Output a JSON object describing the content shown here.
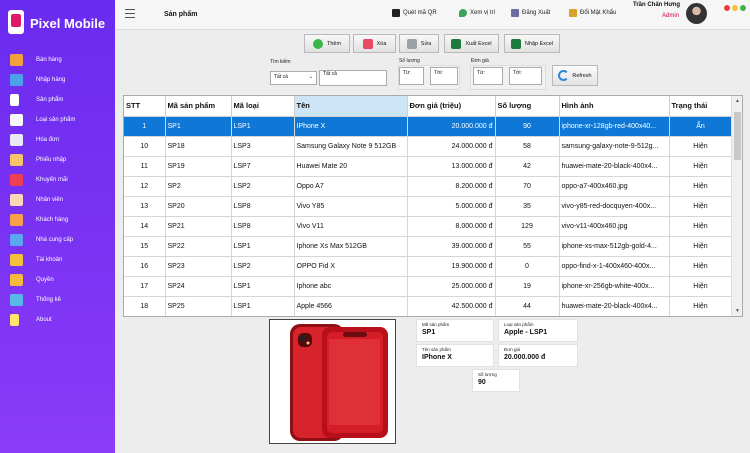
{
  "sidebar": {
    "app_name": "Pixel Mobile",
    "items": [
      {
        "label": "Bán hàng",
        "icon": "cash-register-icon",
        "color": "#f2a03a"
      },
      {
        "label": "Nhập hàng",
        "icon": "truck-icon",
        "color": "#4aa3e8"
      },
      {
        "label": "Sản phẩm",
        "icon": "phone-icon",
        "color": "#ffffff"
      },
      {
        "label": "Loại sản phẩm",
        "icon": "category-icon",
        "color": "#f7f7f7"
      },
      {
        "label": "Hóa đơn",
        "icon": "invoice-icon",
        "color": "#e9e9f6"
      },
      {
        "label": "Phiếu nhập",
        "icon": "clipboard-icon",
        "color": "#f6c46a"
      },
      {
        "label": "Khuyến mãi",
        "icon": "gift-icon",
        "color": "#ee3f55"
      },
      {
        "label": "Nhân viên",
        "icon": "staff-icon",
        "color": "#fbd7b5"
      },
      {
        "label": "Khách hàng",
        "icon": "customer-icon",
        "color": "#f6a14a"
      },
      {
        "label": "Nhà cung cấp",
        "icon": "supplier-icon",
        "color": "#5aa7f0"
      },
      {
        "label": "Tài khoản",
        "icon": "key-icon",
        "color": "#f3c13a"
      },
      {
        "label": "Quyền",
        "icon": "shield-icon",
        "color": "#f5b93b"
      },
      {
        "label": "Thống kê",
        "icon": "statistics-icon",
        "color": "#58b9e6"
      },
      {
        "label": "About",
        "icon": "info-icon",
        "color": "#ffe66b"
      }
    ]
  },
  "header": {
    "title": "Sản phẩm",
    "actions": [
      {
        "label": "Quét mã QR",
        "icon": "qr-code-icon"
      },
      {
        "label": "Xem vị trí",
        "icon": "location-pin-icon"
      },
      {
        "label": "Đăng Xuất",
        "icon": "logout-icon"
      },
      {
        "label": "Đổi Mật Khẩu",
        "icon": "key-icon"
      }
    ],
    "user_name": "Trần Chấn Hưng",
    "user_role": "Admin",
    "window_dots": [
      "#e4463d",
      "#f6c13d",
      "#3bb54a"
    ]
  },
  "toolbar": {
    "add": "Thêm",
    "delete": "Xóa",
    "edit": "Sửa",
    "export": "Xuất Excel",
    "import": "Nhập Excel"
  },
  "filters": {
    "search_label": "Tìm kiếm",
    "search_select": "Tất cả",
    "search_value": "Tất cả",
    "qty_label": "Số lượng",
    "qty_from": "Từ:",
    "qty_to": "Tới:",
    "price_label": "Đơn giá",
    "price_from": "Từ:",
    "price_to": "Tới:",
    "refresh": "Refresh"
  },
  "table": {
    "columns": [
      "STT",
      "Mã sản phẩm",
      "Mã loại",
      "Tên",
      "Đơn giá (triệu)",
      "Số lượng",
      "Hình ảnh",
      "Trạng thái"
    ],
    "rows": [
      [
        "1",
        "SP1",
        "LSP1",
        "IPhone X",
        "20.000.000 đ",
        "90",
        "iphone-xr-128gb-red-400x40...",
        "Ẩn"
      ],
      [
        "10",
        "SP18",
        "LSP3",
        "Samsung Galaxy Note 9 512GB",
        "24.000.000 đ",
        "58",
        "samsung-galaxy-note-9-512g...",
        "Hiện"
      ],
      [
        "11",
        "SP19",
        "LSP7",
        "Huawei Mate 20",
        "13.000.000 đ",
        "42",
        "huawei-mate-20-black-400x4...",
        "Hiện"
      ],
      [
        "12",
        "SP2",
        "LSP2",
        "Oppo A7",
        "8.200.000 đ",
        "70",
        "oppo-a7-400x460.jpg",
        "Hiện"
      ],
      [
        "13",
        "SP20",
        "LSP8",
        "Vivo Y85",
        "5.000.000 đ",
        "35",
        "vivo-y85-red-docquyen-400x...",
        "Hiện"
      ],
      [
        "14",
        "SP21",
        "LSP8",
        "Vivo V11",
        "8.000.000 đ",
        "129",
        "vivo-v11-400x460.jpg",
        "Hiện"
      ],
      [
        "15",
        "SP22",
        "LSP1",
        "Iphone Xs Max 512GB",
        "39.000.000 đ",
        "55",
        "iphone-xs-max-512gb-gold-4...",
        "Hiện"
      ],
      [
        "16",
        "SP23",
        "LSP2",
        "OPPO Fid X",
        "19.900.000 đ",
        "0",
        "oppo-find-x-1-400x460-400x...",
        "Hiện"
      ],
      [
        "17",
        "SP24",
        "LSP1",
        "Iphone abc",
        "25.000.000 đ",
        "19",
        "iphone-xr-256gb-white-400x...",
        "Hiện"
      ],
      [
        "18",
        "SP25",
        "LSP1",
        "Apple 4566",
        "42.500.000 đ",
        "44",
        "huawei-mate-20-black-400x4...",
        "Hiện"
      ]
    ]
  },
  "detail": {
    "product_code_label": "Mã sản phẩm",
    "product_code": "SP1",
    "type_label": "Loại sản phẩm",
    "type_value": "Apple - LSP1",
    "name_label": "Tên sản phẩm",
    "name_value": "IPhone X",
    "price_label": "Đơn giá",
    "price_value": "20.000.000 đ",
    "qty_label": "Số lượng",
    "qty_value": "90"
  },
  "colors": {
    "sidebar": "#7b33f3",
    "selected_row": "#0f78d7",
    "admin": "#d0004a"
  }
}
